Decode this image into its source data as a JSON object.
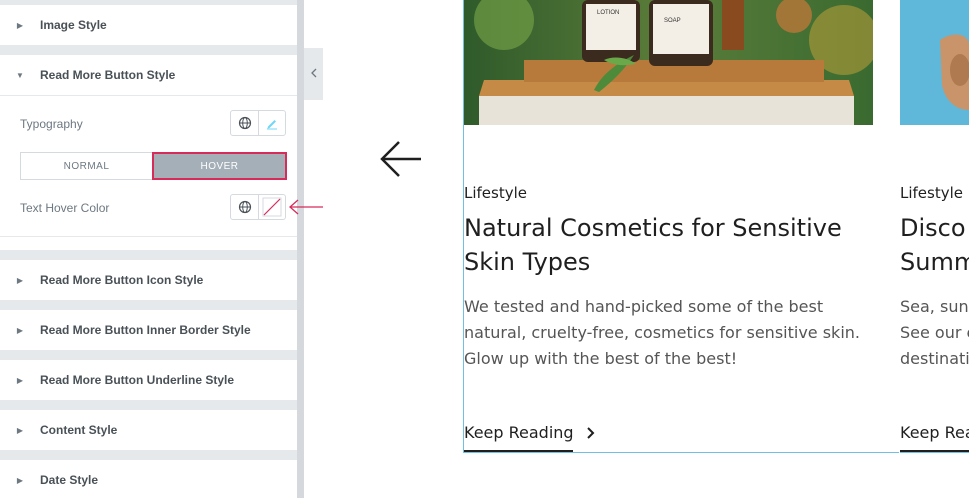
{
  "panel": {
    "sections_top": [
      {
        "label": "Image Style",
        "state": "collapsed"
      }
    ],
    "active_section": {
      "label": "Read More Button Style",
      "state": "expanded",
      "typography_label": "Typography",
      "tabs": [
        "NORMAL",
        "HOVER"
      ],
      "active_tab": "HOVER",
      "text_hover_color_label": "Text Hover Color",
      "text_hover_color_value": "none"
    },
    "sections_bottom": [
      {
        "label": "Read More Button Icon Style"
      },
      {
        "label": "Read More Button Inner Border Style"
      },
      {
        "label": "Read More Button Underline Style"
      },
      {
        "label": "Content Style"
      },
      {
        "label": "Date Style"
      }
    ],
    "icons": {
      "global": "globe-icon",
      "edit": "pencil-icon",
      "color_none": "no-color-swatch-icon",
      "caret_right": "caret-right-icon",
      "caret_down": "caret-down-icon",
      "collapse": "chevron-left-icon"
    },
    "accent_color": "#d72b5a",
    "edit_icon_color": "#71d7f7"
  },
  "annotation": {
    "arrow_color": "#d72b5a"
  },
  "carousel": {
    "prev_icon": "arrow-left-icon",
    "posts": [
      {
        "category": "Lifestyle",
        "title": "Natural Cosmetics for Sensitive Skin Types",
        "excerpt": "We tested and hand-picked some of the best natural, cruelty-free, cosmetics for sensitive skin. Glow up with the best of the best!",
        "read_more": "Keep Reading",
        "bottles": [
          "LOTION",
          "SOAP"
        ]
      },
      {
        "category": "Lifestyle",
        "title": "Disco Summ",
        "title_lines": [
          "Disco",
          "Summ"
        ],
        "excerpt_lines": [
          "Sea, sun,",
          "See our e",
          "destinati"
        ],
        "read_more": "Keep Rea"
      }
    ],
    "card_border_color": "#6ec1e4"
  }
}
